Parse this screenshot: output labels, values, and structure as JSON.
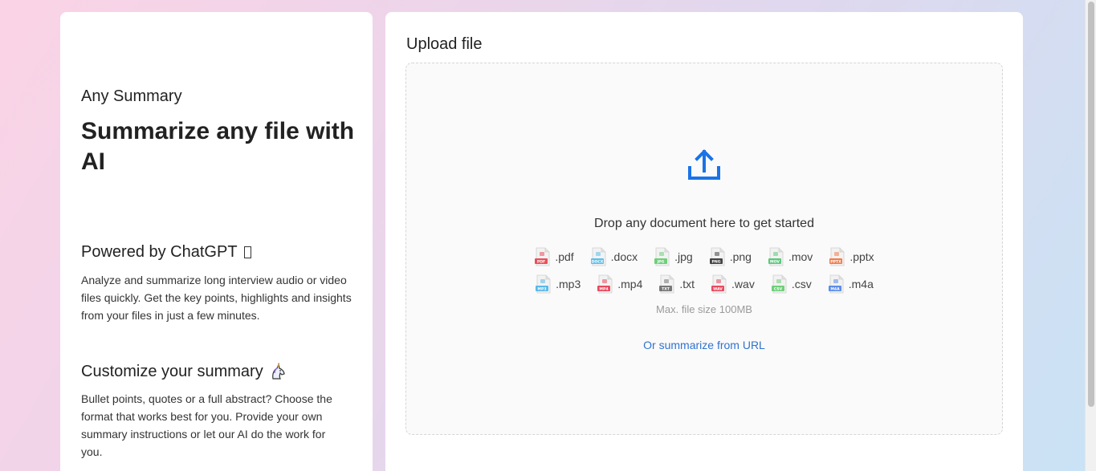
{
  "left": {
    "brand": "Any Summary",
    "hero": "Summarize any file with AI",
    "section1": {
      "title": "Powered by ChatGPT",
      "text": "Analyze and summarize long interview audio or video files quickly. Get the key points, highlights and insights from your files in just a few minutes."
    },
    "section2": {
      "title": "Customize your summary",
      "text": "Bullet points, quotes or a full abstract? Choose the format that works best for you. Provide your own summary instructions or let our AI do the work for you."
    }
  },
  "upload": {
    "title": "Upload file",
    "drop_text": "Drop any document here to get started",
    "max_size": "Max. file size 100MB",
    "url_link": "Or summarize from URL",
    "accent": "#1a73e8",
    "row1": [
      {
        "ext": ".pdf",
        "tag": "PDF",
        "color": "#e8505b"
      },
      {
        "ext": ".docx",
        "tag": "DOCX",
        "color": "#5bc0eb"
      },
      {
        "ext": ".jpg",
        "tag": "JPG",
        "color": "#6fcf7a"
      },
      {
        "ext": ".png",
        "tag": "PNG",
        "color": "#444444"
      },
      {
        "ext": ".mov",
        "tag": "MOV",
        "color": "#5cc97b"
      },
      {
        "ext": ".pptx",
        "tag": "PPTX",
        "color": "#f07d4a"
      }
    ],
    "row2": [
      {
        "ext": ".mp3",
        "tag": "MP3",
        "color": "#5bb8e8"
      },
      {
        "ext": ".mp4",
        "tag": "MP4",
        "color": "#e84a5f"
      },
      {
        "ext": ".txt",
        "tag": "TXT",
        "color": "#777777"
      },
      {
        "ext": ".wav",
        "tag": "WAV",
        "color": "#e84a5f"
      },
      {
        "ext": ".csv",
        "tag": "CSV",
        "color": "#6fcf7a"
      },
      {
        "ext": ".m4a",
        "tag": "M4A",
        "color": "#5b8de8"
      }
    ]
  }
}
